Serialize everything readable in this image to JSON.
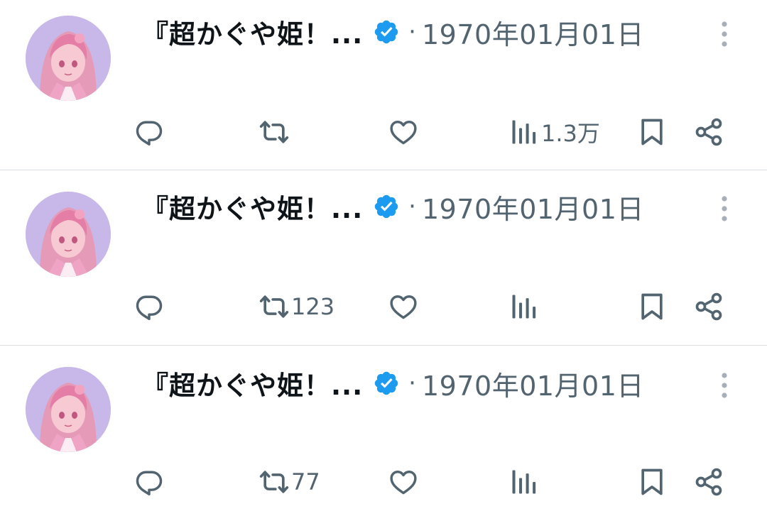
{
  "tweets": [
    {
      "author_name": "『超かぐや姫！...",
      "separator": "·",
      "date": "1970年01月01日",
      "reply_count": "",
      "retweet_count": "",
      "like_count": "",
      "view_count": "1.3万"
    },
    {
      "author_name": "『超かぐや姫！...",
      "separator": "·",
      "date": "1970年01月01日",
      "reply_count": "",
      "retweet_count": "123",
      "like_count": "",
      "view_count": ""
    },
    {
      "author_name": "『超かぐや姫！...",
      "separator": "·",
      "date": "1970年01月01日",
      "reply_count": "",
      "retweet_count": "77",
      "like_count": "",
      "view_count": ""
    }
  ],
  "icons": {
    "verified": "verified-badge-icon",
    "more": "more-vertical-icon",
    "reply": "reply-icon",
    "retweet": "retweet-icon",
    "like": "heart-icon",
    "views": "views-chart-icon",
    "bookmark": "bookmark-icon",
    "share": "share-icon"
  },
  "colors": {
    "text_primary": "#0f1419",
    "text_secondary": "#536471",
    "verified_blue": "#1d9bf0",
    "divider": "#d9dde0"
  }
}
